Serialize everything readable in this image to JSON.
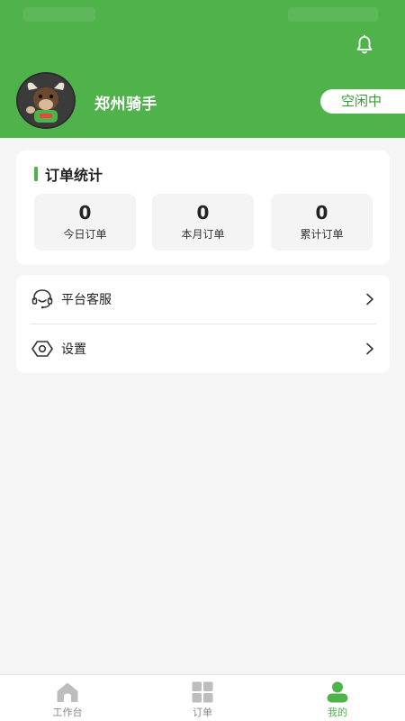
{
  "colors": {
    "brand": "#4fb24a",
    "tab_inactive": "#bdbdbd"
  },
  "header": {
    "username": "郑州骑手",
    "status": "空闲中"
  },
  "stats": {
    "title": "订单统计",
    "items": [
      {
        "value": "0",
        "label": "今日订单"
      },
      {
        "value": "0",
        "label": "本月订单"
      },
      {
        "value": "0",
        "label": "累计订单"
      }
    ]
  },
  "menu": {
    "items": [
      {
        "label": "平台客服",
        "icon": "headset-icon"
      },
      {
        "label": "设置",
        "icon": "settings-hex-icon"
      }
    ]
  },
  "tabbar": {
    "items": [
      {
        "label": "工作台",
        "icon": "home-icon",
        "active": false
      },
      {
        "label": "订单",
        "icon": "grid-icon",
        "active": false
      },
      {
        "label": "我的",
        "icon": "user-icon",
        "active": true
      }
    ]
  }
}
